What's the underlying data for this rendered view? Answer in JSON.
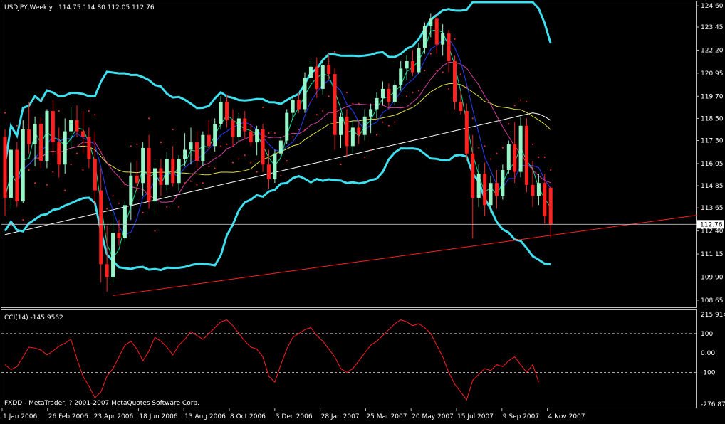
{
  "header": {
    "symbol_title": "USDJPY,Weekly",
    "ohlc": "114.75 114.80 112.05 112.76"
  },
  "watermark": "FXDD - MetaTrader, ? 2001-2007 MetaQuotes Software Corp.",
  "colors": {
    "background": "#000000",
    "frame": "#c0c0c0",
    "bull_candle": "#98f5c8",
    "bear_candle": "#ff2020",
    "bollinger": "#3ee0f0",
    "ma_fast": "#00e0a0",
    "ma_blue": "#2040ff",
    "ma_pink": "#d040a0",
    "ma_yellow": "#e0e040",
    "ma_long": "#ffffff",
    "parabolic_sar": "#ff3030",
    "trendline": "#ff2020",
    "cci_line": "#ff2020"
  },
  "chart_data": [
    {
      "type": "candlestick",
      "title": "USDJPY,Weekly",
      "current_price_label": "112.76",
      "y_ticks": [
        "124.60",
        "123.45",
        "122.20",
        "120.95",
        "119.70",
        "118.50",
        "117.30",
        "116.05",
        "114.85",
        "113.65",
        "112.40",
        "111.15",
        "109.90",
        "108.65"
      ],
      "ylim": [
        108.3,
        124.8
      ],
      "x_ticks": [
        "1 Jan 2006",
        "26 Feb 2006",
        "23 Apr 2006",
        "18 Jun 2006",
        "13 Aug 2006",
        "8 Oct 2006",
        "3 Dec 2006",
        "28 Jan 2007",
        "25 Mar 2007",
        "20 May 2007",
        "15 Jul 2007",
        "9 Sep 2007",
        "4 Nov 2007"
      ],
      "candles": [
        [
          117.5,
          117.9,
          113.2,
          114.2
        ],
        [
          114.2,
          117.0,
          113.6,
          116.8
        ],
        [
          116.8,
          117.2,
          113.7,
          114.0
        ],
        [
          114.0,
          118.4,
          113.9,
          117.9
        ],
        [
          117.9,
          119.4,
          116.6,
          117.1
        ],
        [
          117.1,
          118.6,
          115.9,
          118.2
        ],
        [
          118.2,
          118.6,
          115.8,
          116.2
        ],
        [
          116.2,
          119.0,
          115.8,
          118.9
        ],
        [
          118.9,
          119.5,
          116.5,
          117.2
        ],
        [
          117.2,
          118.0,
          115.3,
          116.0
        ],
        [
          116.0,
          118.5,
          115.5,
          117.8
        ],
        [
          117.8,
          119.1,
          116.9,
          118.4
        ],
        [
          118.4,
          119.2,
          117.5,
          117.8
        ],
        [
          117.8,
          118.9,
          116.6,
          117.5
        ],
        [
          117.5,
          118.0,
          115.8,
          116.3
        ],
        [
          116.3,
          117.8,
          113.8,
          114.6
        ],
        [
          114.6,
          115.8,
          109.6,
          110.6
        ],
        [
          110.6,
          112.7,
          109.1,
          109.9
        ],
        [
          109.9,
          113.4,
          109.6,
          112.3
        ],
        [
          112.3,
          113.0,
          111.6,
          112.0
        ],
        [
          112.0,
          114.0,
          111.8,
          113.8
        ],
        [
          113.8,
          116.1,
          113.0,
          115.4
        ],
        [
          115.4,
          116.2,
          114.5,
          115.0
        ],
        [
          115.0,
          117.2,
          114.3,
          116.9
        ],
        [
          116.9,
          117.6,
          113.6,
          114.0
        ],
        [
          114.0,
          116.2,
          113.3,
          115.8
        ],
        [
          115.8,
          116.3,
          114.3,
          114.9
        ],
        [
          114.9,
          116.7,
          114.6,
          116.3
        ],
        [
          116.3,
          117.0,
          114.8,
          115.0
        ],
        [
          115.0,
          116.5,
          114.6,
          116.3
        ],
        [
          116.3,
          117.7,
          115.9,
          116.8
        ],
        [
          116.8,
          118.0,
          116.0,
          117.2
        ],
        [
          117.2,
          117.8,
          115.8,
          116.2
        ],
        [
          116.2,
          117.8,
          115.9,
          117.6
        ],
        [
          117.6,
          118.4,
          116.8,
          117.0
        ],
        [
          117.0,
          118.5,
          116.7,
          118.2
        ],
        [
          118.2,
          119.7,
          117.9,
          119.4
        ],
        [
          119.4,
          119.8,
          118.0,
          118.4
        ],
        [
          118.4,
          119.0,
          117.0,
          117.5
        ],
        [
          117.5,
          118.8,
          117.2,
          118.5
        ],
        [
          118.5,
          118.9,
          117.4,
          117.8
        ],
        [
          117.8,
          118.2,
          117.0,
          117.2
        ],
        [
          117.2,
          118.1,
          116.5,
          117.9
        ],
        [
          117.9,
          118.2,
          115.6,
          116.0
        ],
        [
          116.0,
          116.8,
          114.7,
          115.2
        ],
        [
          115.2,
          116.8,
          115.0,
          116.6
        ],
        [
          116.6,
          117.5,
          116.3,
          117.3
        ],
        [
          117.3,
          119.0,
          117.1,
          118.8
        ],
        [
          118.8,
          119.7,
          118.4,
          119.5
        ],
        [
          119.5,
          119.9,
          118.8,
          119.0
        ],
        [
          119.0,
          121.0,
          118.8,
          120.7
        ],
        [
          120.7,
          121.6,
          120.3,
          121.3
        ],
        [
          121.3,
          121.8,
          119.6,
          120.1
        ],
        [
          120.1,
          121.8,
          119.8,
          121.4
        ],
        [
          121.4,
          122.0,
          120.6,
          120.9
        ],
        [
          120.9,
          121.2,
          116.8,
          117.6
        ],
        [
          117.6,
          118.8,
          116.9,
          118.6
        ],
        [
          118.6,
          119.0,
          116.4,
          117.0
        ],
        [
          117.0,
          118.4,
          116.6,
          118.0
        ],
        [
          118.0,
          118.4,
          117.1,
          117.6
        ],
        [
          117.6,
          119.0,
          117.3,
          118.6
        ],
        [
          118.6,
          119.3,
          117.7,
          119.0
        ],
        [
          119.0,
          119.9,
          118.5,
          119.6
        ],
        [
          119.6,
          120.5,
          119.2,
          120.1
        ],
        [
          120.1,
          120.4,
          119.0,
          119.4
        ],
        [
          119.4,
          120.6,
          119.2,
          120.3
        ],
        [
          120.3,
          121.6,
          120.0,
          121.2
        ],
        [
          121.2,
          121.9,
          120.6,
          121.6
        ],
        [
          121.6,
          122.2,
          120.8,
          121.0
        ],
        [
          121.0,
          122.6,
          120.9,
          122.3
        ],
        [
          122.3,
          123.7,
          122.0,
          123.5
        ],
        [
          123.5,
          124.2,
          122.9,
          123.9
        ],
        [
          123.9,
          124.1,
          122.0,
          122.5
        ],
        [
          122.5,
          123.6,
          121.9,
          123.1
        ],
        [
          123.1,
          123.3,
          121.0,
          121.6
        ],
        [
          121.6,
          121.9,
          119.0,
          119.4
        ],
        [
          119.4,
          120.0,
          118.7,
          118.9
        ],
        [
          118.9,
          119.3,
          116.2,
          116.6
        ],
        [
          116.6,
          117.6,
          112.0,
          114.2
        ],
        [
          114.2,
          116.0,
          113.7,
          115.5
        ],
        [
          115.5,
          116.1,
          113.2,
          113.8
        ],
        [
          113.8,
          115.4,
          113.4,
          115.0
        ],
        [
          115.0,
          115.7,
          113.6,
          114.3
        ],
        [
          114.3,
          116.0,
          114.1,
          115.7
        ],
        [
          115.7,
          117.3,
          115.5,
          117.1
        ],
        [
          117.1,
          118.3,
          115.0,
          115.6
        ],
        [
          115.6,
          118.6,
          115.3,
          118.1
        ],
        [
          118.1,
          118.5,
          114.5,
          114.9
        ],
        [
          114.9,
          116.2,
          113.7,
          114.3
        ],
        [
          114.3,
          115.5,
          113.8,
          115.0
        ],
        [
          115.0,
          115.5,
          112.8,
          113.2
        ],
        [
          114.75,
          114.8,
          112.05,
          112.76
        ]
      ]
    },
    {
      "type": "line",
      "title": "CCI(14) -145.9562",
      "y_ticks": [
        "215.914",
        "100",
        "0.00",
        "-100",
        "-276.876"
      ],
      "ylim": [
        -276.876,
        215.914
      ],
      "values": [
        -60,
        -85,
        -70,
        -20,
        30,
        25,
        15,
        -10,
        10,
        35,
        50,
        70,
        -30,
        -120,
        -170,
        -230,
        -200,
        -120,
        -80,
        -20,
        40,
        60,
        20,
        -40,
        10,
        80,
        60,
        30,
        -10,
        40,
        70,
        110,
        90,
        70,
        100,
        130,
        160,
        170,
        140,
        100,
        60,
        30,
        20,
        -20,
        -120,
        -150,
        -60,
        20,
        80,
        100,
        120,
        130,
        90,
        60,
        20,
        -20,
        -80,
        -100,
        -80,
        -40,
        0,
        40,
        60,
        90,
        120,
        150,
        170,
        160,
        140,
        150,
        130,
        100,
        40,
        -20,
        -100,
        -160,
        -200,
        -240,
        -140,
        -110,
        -80,
        -90,
        -60,
        -70,
        -40,
        -20,
        -60,
        -100,
        -60,
        -150
      ]
    }
  ]
}
